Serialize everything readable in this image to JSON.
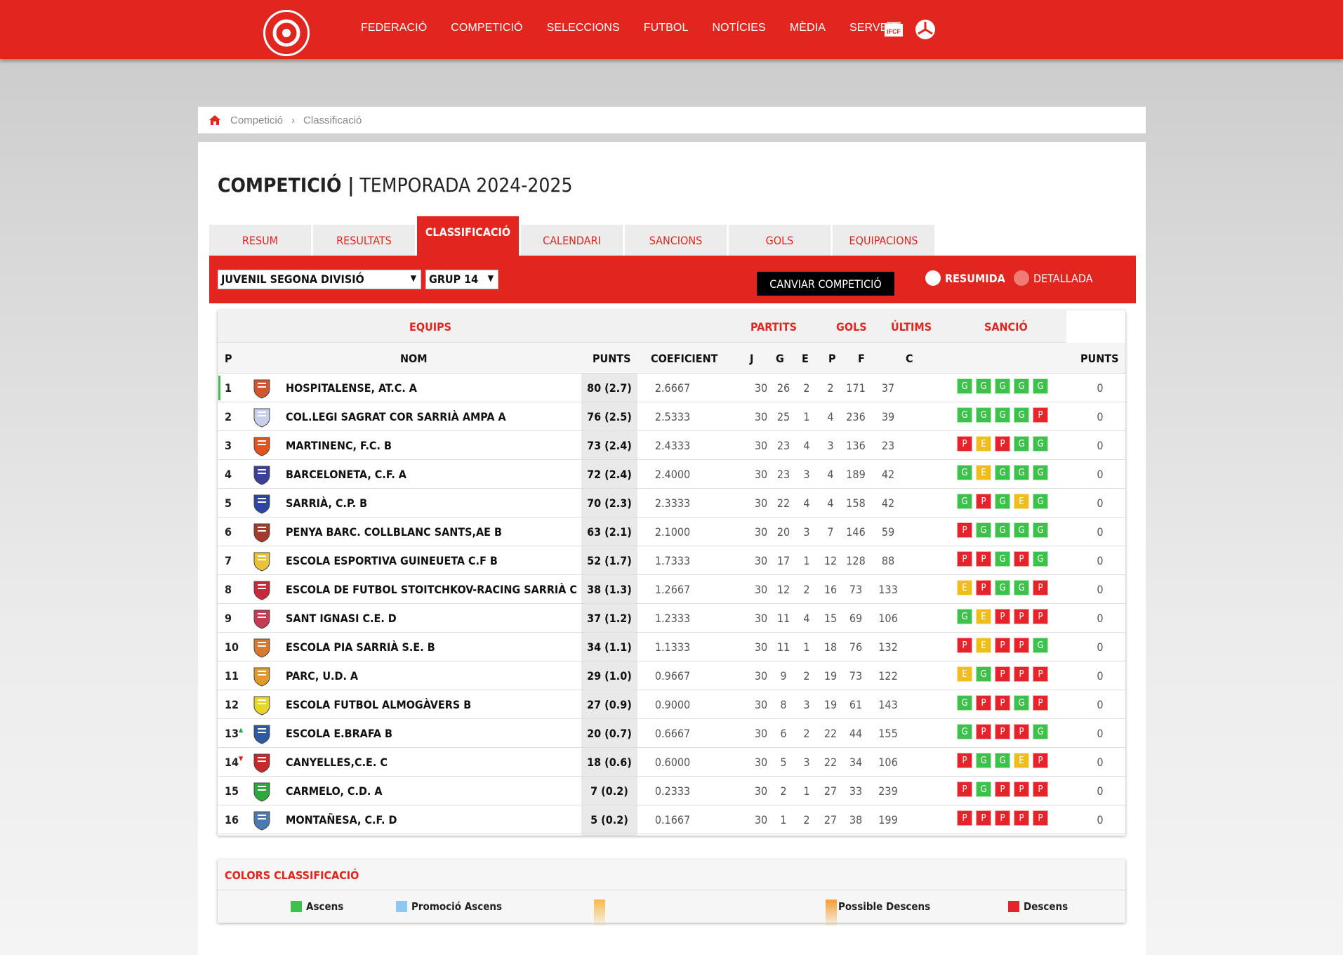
{
  "nav": {
    "items": [
      "FEDERACIÓ",
      "COMPETICIÓ",
      "SELECCIONS",
      "FUTBOL",
      "NOTÍCIES",
      "MÈDIA",
      "SERVEIS"
    ],
    "ifcf_label": "iFCF"
  },
  "breadcrumb": {
    "items": [
      "Competició",
      "Classificació"
    ],
    "separator": "›"
  },
  "page": {
    "title_bold": "COMPETICIÓ |",
    "title_season": "TEMPORADA 2024-2025"
  },
  "tabs": [
    {
      "label": "RESUM",
      "active": false
    },
    {
      "label": "RESULTATS",
      "active": false
    },
    {
      "label": "CLASSIFICACIÓ",
      "active": true
    },
    {
      "label": "CALENDARI",
      "active": false
    },
    {
      "label": "SANCIONS",
      "active": false
    },
    {
      "label": "GOLS",
      "active": false
    },
    {
      "label": "EQUIPACIONS",
      "active": false
    }
  ],
  "filters": {
    "competition": "JUVENIL SEGONA DIVISIÓ",
    "group": "GRUP 14",
    "change_button": "CANVIAR COMPETICIÓ",
    "view_summary": "RESUMIDA",
    "view_detailed": "DETALLADA"
  },
  "table": {
    "groups": {
      "teams": "EQUIPS",
      "matches": "PARTITS",
      "goals": "GOLS",
      "last": "ÚLTIMS",
      "sanction": "SANCIÓ"
    },
    "headers": {
      "pos": "P",
      "name": "NOM",
      "points": "PUNTS",
      "coef": "COEFICIENT",
      "j": "J",
      "g": "G",
      "e": "E",
      "p": "P",
      "f": "F",
      "c": "C",
      "sanction_points": "PUNTS"
    },
    "rows": [
      {
        "pos": "1",
        "name": "HOSPITALENSE, AT.C. A",
        "points": "80 (2.7)",
        "coef": "2.6667",
        "j": "30",
        "g": "26",
        "e": "2",
        "p": "2",
        "f": "171",
        "c": "37",
        "last": [
          "G",
          "G",
          "G",
          "G",
          "G"
        ],
        "sanc": "0",
        "crest": "#d2552e",
        "trend": "",
        "leader": true
      },
      {
        "pos": "2",
        "name": "COL.LEGI SAGRAT COR SARRIÀ AMPA A",
        "points": "76 (2.5)",
        "coef": "2.5333",
        "j": "30",
        "g": "25",
        "e": "1",
        "p": "4",
        "f": "236",
        "c": "39",
        "last": [
          "G",
          "G",
          "G",
          "G",
          "P"
        ],
        "sanc": "0",
        "crest": "#c7d0e8",
        "trend": ""
      },
      {
        "pos": "3",
        "name": "MARTINENC, F.C. B",
        "points": "73 (2.4)",
        "coef": "2.4333",
        "j": "30",
        "g": "23",
        "e": "4",
        "p": "3",
        "f": "136",
        "c": "23",
        "last": [
          "P",
          "E",
          "P",
          "G",
          "G"
        ],
        "sanc": "0",
        "crest": "#e2531e",
        "trend": ""
      },
      {
        "pos": "4",
        "name": "BARCELONETA, C.F. A",
        "points": "72 (2.4)",
        "coef": "2.4000",
        "j": "30",
        "g": "23",
        "e": "3",
        "p": "4",
        "f": "189",
        "c": "42",
        "last": [
          "G",
          "E",
          "G",
          "G",
          "G"
        ],
        "sanc": "0",
        "crest": "#3b3f9a",
        "trend": ""
      },
      {
        "pos": "5",
        "name": "SARRIÀ, C.P. B",
        "points": "70 (2.3)",
        "coef": "2.3333",
        "j": "30",
        "g": "22",
        "e": "4",
        "p": "4",
        "f": "158",
        "c": "42",
        "last": [
          "G",
          "P",
          "G",
          "E",
          "G"
        ],
        "sanc": "0",
        "crest": "#2d46a6",
        "trend": ""
      },
      {
        "pos": "6",
        "name": "PENYA BARC. COLLBLANC SANTS,AE B",
        "points": "63 (2.1)",
        "coef": "2.1000",
        "j": "30",
        "g": "20",
        "e": "3",
        "p": "7",
        "f": "146",
        "c": "59",
        "last": [
          "P",
          "G",
          "G",
          "G",
          "G"
        ],
        "sanc": "0",
        "crest": "#a33a2a",
        "trend": ""
      },
      {
        "pos": "7",
        "name": "ESCOLA ESPORTIVA GUINEUETA C.F B",
        "points": "52 (1.7)",
        "coef": "1.7333",
        "j": "30",
        "g": "17",
        "e": "1",
        "p": "12",
        "f": "128",
        "c": "88",
        "last": [
          "P",
          "P",
          "G",
          "P",
          "G"
        ],
        "sanc": "0",
        "crest": "#e8c23a",
        "trend": ""
      },
      {
        "pos": "8",
        "name": "ESCOLA DE FUTBOL STOITCHKOV-RACING SARRIÀ C",
        "points": "38 (1.3)",
        "coef": "1.2667",
        "j": "30",
        "g": "12",
        "e": "2",
        "p": "16",
        "f": "73",
        "c": "133",
        "last": [
          "E",
          "P",
          "G",
          "G",
          "P"
        ],
        "sanc": "0",
        "crest": "#c8283a",
        "trend": ""
      },
      {
        "pos": "9",
        "name": "SANT IGNASI C.E. D",
        "points": "37 (1.2)",
        "coef": "1.2333",
        "j": "30",
        "g": "11",
        "e": "4",
        "p": "15",
        "f": "69",
        "c": "106",
        "last": [
          "G",
          "E",
          "P",
          "P",
          "P"
        ],
        "sanc": "0",
        "crest": "#c73a53",
        "trend": ""
      },
      {
        "pos": "10",
        "name": "ESCOLA PIA SARRIÀ S.E. B",
        "points": "34 (1.1)",
        "coef": "1.1333",
        "j": "30",
        "g": "11",
        "e": "1",
        "p": "18",
        "f": "76",
        "c": "132",
        "last": [
          "P",
          "E",
          "P",
          "P",
          "G"
        ],
        "sanc": "0",
        "crest": "#d57a2e",
        "trend": ""
      },
      {
        "pos": "11",
        "name": "PARC, U.D. A",
        "points": "29 (1.0)",
        "coef": "0.9667",
        "j": "30",
        "g": "9",
        "e": "2",
        "p": "19",
        "f": "73",
        "c": "122",
        "last": [
          "E",
          "G",
          "P",
          "P",
          "P"
        ],
        "sanc": "0",
        "crest": "#e09a2a",
        "trend": ""
      },
      {
        "pos": "12",
        "name": "ESCOLA FUTBOL ALMOGÀVERS B",
        "points": "27 (0.9)",
        "coef": "0.9000",
        "j": "30",
        "g": "8",
        "e": "3",
        "p": "19",
        "f": "61",
        "c": "143",
        "last": [
          "G",
          "P",
          "P",
          "G",
          "P"
        ],
        "sanc": "0",
        "crest": "#e8d52a",
        "trend": ""
      },
      {
        "pos": "13",
        "name": "ESCOLA E.BRAFA B",
        "points": "20 (0.7)",
        "coef": "0.6667",
        "j": "30",
        "g": "6",
        "e": "2",
        "p": "22",
        "f": "44",
        "c": "155",
        "last": [
          "G",
          "P",
          "P",
          "P",
          "G"
        ],
        "sanc": "0",
        "crest": "#2d5aa0",
        "trend": "up"
      },
      {
        "pos": "14",
        "name": "CANYELLES,C.E. C",
        "points": "18 (0.6)",
        "coef": "0.6000",
        "j": "30",
        "g": "5",
        "e": "3",
        "p": "22",
        "f": "34",
        "c": "106",
        "last": [
          "P",
          "G",
          "G",
          "E",
          "P"
        ],
        "sanc": "0",
        "crest": "#c42a2a",
        "trend": "down"
      },
      {
        "pos": "15",
        "name": "CARMELO, C.D. A",
        "points": "7 (0.2)",
        "coef": "0.2333",
        "j": "30",
        "g": "2",
        "e": "1",
        "p": "27",
        "f": "33",
        "c": "239",
        "last": [
          "P",
          "G",
          "P",
          "P",
          "P"
        ],
        "sanc": "0",
        "crest": "#2ea83a",
        "trend": ""
      },
      {
        "pos": "16",
        "name": "MONTAÑESA, C.F. D",
        "points": "5 (0.2)",
        "coef": "0.1667",
        "j": "30",
        "g": "1",
        "e": "2",
        "p": "27",
        "f": "38",
        "c": "199",
        "last": [
          "P",
          "P",
          "P",
          "P",
          "P"
        ],
        "sanc": "0",
        "crest": "#4a7ab0",
        "trend": ""
      }
    ]
  },
  "legend": {
    "title": "COLORS CLASSIFICACIÓ",
    "items": [
      {
        "label": "Ascens",
        "color": "#3ec04c"
      },
      {
        "label": "Promoció Ascens",
        "color": "#8cc8f0"
      },
      {
        "label": "Possible Descens",
        "color": "#f0a030"
      },
      {
        "label": "Descens",
        "color": "#e3242b"
      }
    ]
  },
  "colors": {
    "brand_red": "#e0261f",
    "win": "#3ec04c",
    "loss": "#e3242b",
    "draw": "#efbd1e"
  }
}
